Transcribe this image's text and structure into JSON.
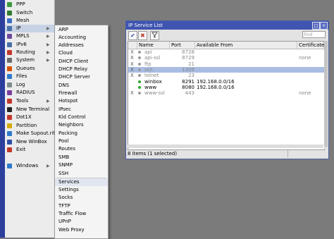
{
  "sidebar": {
    "items": [
      {
        "label": "PPP",
        "icon": "ppp-icon",
        "color": "#3d9a3d",
        "submenu": false
      },
      {
        "label": "Switch",
        "icon": "switch-icon",
        "color": "#2f7d2f",
        "submenu": false
      },
      {
        "label": "Mesh",
        "icon": "mesh-icon",
        "color": "#3a6fc2",
        "submenu": false
      },
      {
        "label": "IP",
        "icon": "ip-icon",
        "color": "#4a6fa8",
        "submenu": true
      },
      {
        "label": "MPLS",
        "icon": "mpls-icon",
        "color": "#6d4a9e",
        "submenu": true
      },
      {
        "label": "IPv6",
        "icon": "ipv6-icon",
        "color": "#4a6fa8",
        "submenu": true
      },
      {
        "label": "Routing",
        "icon": "routing-icon",
        "color": "#c0392b",
        "submenu": true
      },
      {
        "label": "System",
        "icon": "system-icon",
        "color": "#6b6b6b",
        "submenu": true
      },
      {
        "label": "Queues",
        "icon": "queues-icon",
        "color": "#d35400",
        "submenu": false
      },
      {
        "label": "Files",
        "icon": "files-icon",
        "color": "#2f7acb",
        "submenu": false
      },
      {
        "label": "Log",
        "icon": "log-icon",
        "color": "#7f8c8d",
        "submenu": false
      },
      {
        "label": "RADIUS",
        "icon": "radius-icon",
        "color": "#7b3fa0",
        "submenu": false
      },
      {
        "label": "Tools",
        "icon": "tools-icon",
        "color": "#c0392b",
        "submenu": true
      },
      {
        "label": "New Terminal",
        "icon": "terminal-icon",
        "color": "#222222",
        "submenu": false
      },
      {
        "label": "Dot1X",
        "icon": "dot1x-icon",
        "color": "#c0392b",
        "submenu": false
      },
      {
        "label": "Partition",
        "icon": "partition-icon",
        "color": "#d4ac0d",
        "submenu": false
      },
      {
        "label": "Make Supout.rif",
        "icon": "supout-icon",
        "color": "#2f7acb",
        "submenu": false
      },
      {
        "label": "New WinBox",
        "icon": "winbox-icon",
        "color": "#2f4fa8",
        "submenu": false
      },
      {
        "label": "Exit",
        "icon": "exit-icon",
        "color": "#c0392b",
        "submenu": false
      },
      {
        "label": "Windows",
        "icon": "windows-icon",
        "color": "#2f7acb",
        "submenu": true
      }
    ],
    "selected": 3
  },
  "ip_submenu": {
    "items": [
      "ARP",
      "Accounting",
      "Addresses",
      "Cloud",
      "DHCP Client",
      "DHCP Relay",
      "DHCP Server",
      "DNS",
      "Firewall",
      "Hotspot",
      "IPsec",
      "Kid Control",
      "Neighbors",
      "Packing",
      "Pool",
      "Routes",
      "SMB",
      "SNMP",
      "SSH",
      "Services",
      "Settings",
      "Socks",
      "TFTP",
      "Traffic Flow",
      "UPnP",
      "Web Proxy"
    ],
    "hovered": 19
  },
  "window": {
    "title": "IP Service List",
    "search_placeholder": "Find",
    "columns": [
      "Name",
      "Port",
      "Available From",
      "Certificate"
    ],
    "rows": [
      {
        "flag": "X",
        "name": "api",
        "port": "8728",
        "available_from": "",
        "certificate": "",
        "enabled": false
      },
      {
        "flag": "X",
        "name": "api-ssl",
        "port": "8729",
        "available_from": "",
        "certificate": "none",
        "enabled": false
      },
      {
        "flag": "X",
        "name": "ftp",
        "port": "21",
        "available_from": "",
        "certificate": "",
        "enabled": false
      },
      {
        "flag": "X",
        "name": "ssh",
        "port": "1309",
        "available_from": "",
        "certificate": "",
        "enabled": false
      },
      {
        "flag": "X",
        "name": "telnet",
        "port": "23",
        "available_from": "",
        "certificate": "",
        "enabled": false
      },
      {
        "flag": "",
        "name": "winbox",
        "port": "8291",
        "available_from": "192.168.0.0/16",
        "certificate": "",
        "enabled": true
      },
      {
        "flag": "",
        "name": "www",
        "port": "8080",
        "available_from": "192.168.0.0/16",
        "certificate": "",
        "enabled": true
      },
      {
        "flag": "X",
        "name": "www-ssl",
        "port": "443",
        "available_from": "",
        "certificate": "none",
        "enabled": false
      }
    ],
    "selected_row": 3,
    "status": "8 items (1 selected)"
  }
}
